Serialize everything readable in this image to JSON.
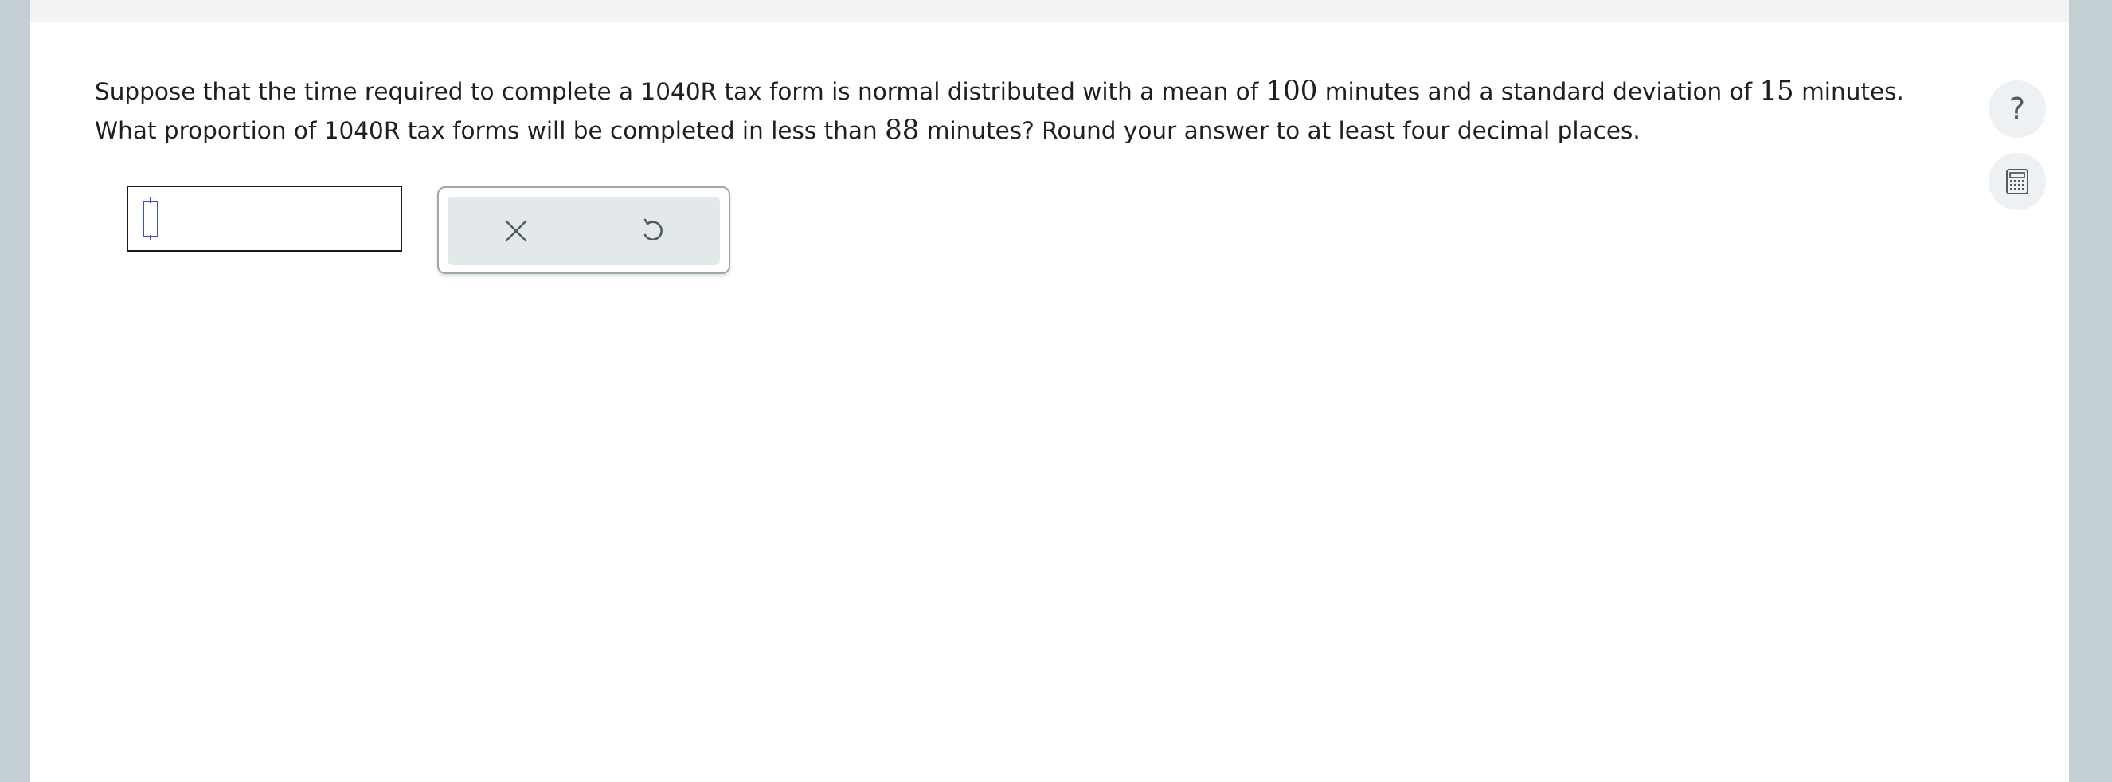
{
  "question": {
    "part1": "Suppose that the time required to complete a 1040R tax form is normal distributed with a mean of ",
    "mean": "100",
    "part2": " minutes and a standard deviation of ",
    "sd": "15",
    "part3": " minutes. What proportion of 1040R tax forms will be completed in less than ",
    "threshold": "88",
    "part4": " minutes? Round your answer to at least four decimal places."
  },
  "answer": {
    "value": ""
  },
  "toolbox": {
    "clear_icon": "close-icon",
    "undo_icon": "undo-icon"
  },
  "side_tools": {
    "help_label": "?",
    "calculator_icon": "calculator-icon"
  },
  "colors": {
    "accent_caret": "#3d4bd6",
    "icon_gray": "#4f5a61",
    "toolbox_bg": "#e3e8eb",
    "frame": "#c4cfd4"
  }
}
